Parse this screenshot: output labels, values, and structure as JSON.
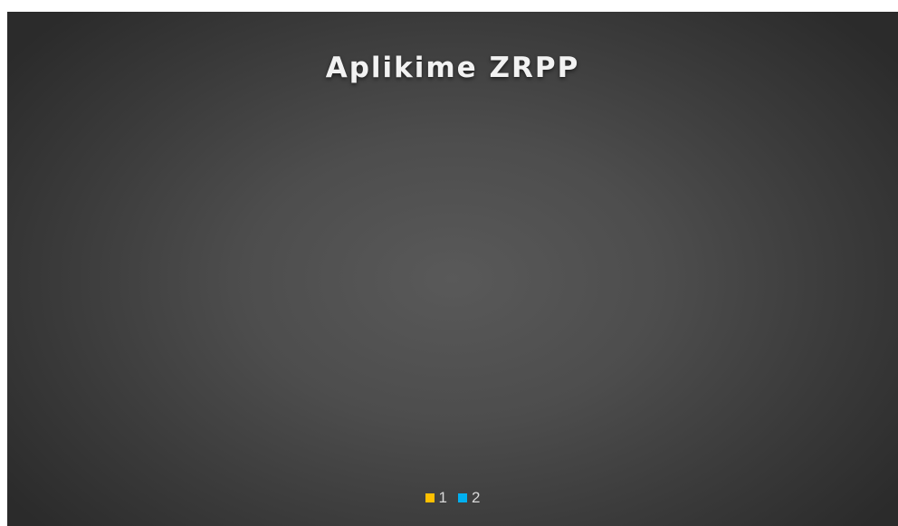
{
  "chart_data": {
    "type": "pie",
    "title": "Aplikime ZRPP",
    "categories": [
      "1",
      "2"
    ],
    "values": [
      0,
      0
    ],
    "colors": [
      "#ffc000",
      "#00b0f0"
    ],
    "legend_position": "bottom",
    "background": "#404040",
    "title_color": "#f2f2f2",
    "text_color": "#d9d9d9"
  }
}
